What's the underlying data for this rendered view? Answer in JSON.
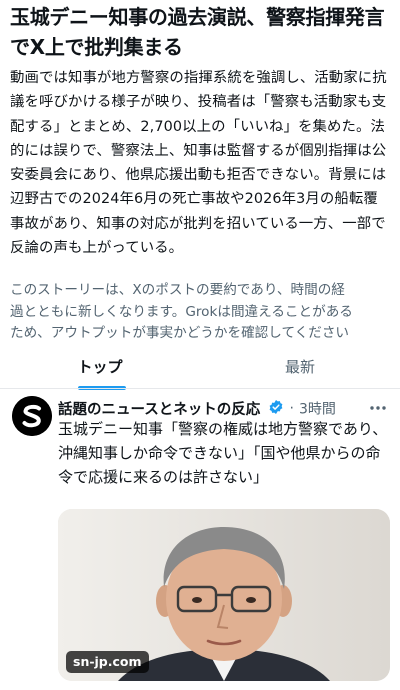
{
  "story": {
    "headline": "玉城デニー知事の過去演説、警察指揮発言でX上で批判集まる",
    "summary": "動画では知事が地方警察の指揮系統を強調し、活動家に抗議を呼びかける様子が映り、投稿者は「警察も活動家も支配する」とまとめ、2,700以上の「いいね」を集めた。法的には誤りで、警察法上、知事は監督するが個別指揮は公安委員会にあり、他県応援出動も拒否できない。背景には辺野古での2024年6月の死亡事故や2026年3月の船転覆事故があり、知事の対応が批判を招いている一方、一部で反論の声も上がっている。",
    "disclaimer_line1": "このストーリーは、Xのポストの要約であり、時間の経",
    "disclaimer_line2": "過とともに新しくなります。Grokは間違えることがある",
    "disclaimer_line3": "ため、アウトプットが事実かどうかを確認してください"
  },
  "tabs": [
    {
      "label": "トップ",
      "active": true
    },
    {
      "label": "最新",
      "active": false
    }
  ],
  "post": {
    "author": "話題のニュースとネットの反応",
    "separator": "·",
    "time": "3時間",
    "text": "玉城デニー知事「警察の権威は地方警察であり、沖縄知事しか命令できない」「国や他県からの命令で応援に来るのは許さない」",
    "media_source": "sn-jp.com",
    "avatar_icon": "s-logo-icon",
    "verified_icon": "verified-badge-icon",
    "more_icon": "more-options-icon"
  },
  "colors": {
    "accent": "#1d9bf0",
    "text": "#0f1419",
    "muted": "#536471"
  }
}
